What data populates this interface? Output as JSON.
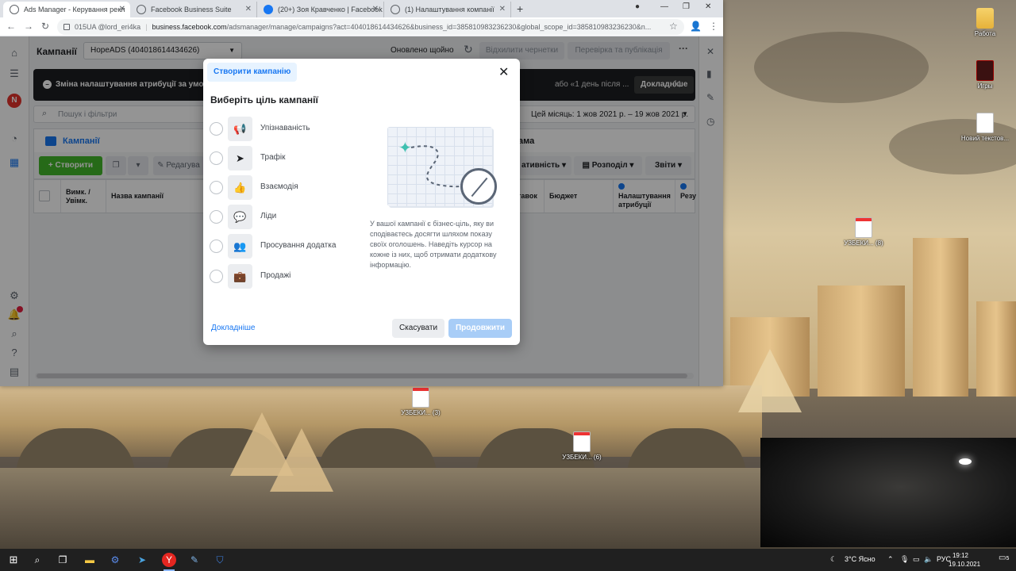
{
  "browser": {
    "tabs": [
      {
        "title": "Ads Manager - Керування рекл",
        "active": true
      },
      {
        "title": "Facebook Business Suite",
        "active": false
      },
      {
        "title": "(20+) Зоя Кравченко | Facebook",
        "active": false
      },
      {
        "title": "(1) Налаштування компанії",
        "active": false
      }
    ],
    "address": {
      "account": "015UA @lord_eri4ka",
      "url_host": "business.facebook.com",
      "url_path": "/adsmanager/manage/campaigns?act=404018614434626&business_id=385810983236230&global_scope_id=385810983236230&n..."
    }
  },
  "app": {
    "header": {
      "title": "Кампанії",
      "account": "HopeADS (404018614434626)",
      "updated": "Оновлено щойно",
      "discard_drafts": "Відхилити чернетки",
      "review_publish": "Перевірка та публікація"
    },
    "banner": {
      "text": "Зміна налаштування атрибуції за умовча",
      "text_tail": "або «1 день після ...",
      "more": "Докладніше"
    },
    "search": {
      "placeholder": "Пошук і фільтри",
      "date_range": "Цей місяць: 1 жов 2021 р. – 19 жов 2021 р."
    },
    "tabs": {
      "campaigns": "Кампанії",
      "ads_tail": "ама"
    },
    "toolbar": {
      "create": "+ Створити",
      "edit": "Редагува",
      "performance": "ативність",
      "breakdown": "Розподіл",
      "reports": "Звіти"
    },
    "table": {
      "col_onoff": "Вимк. / Увімк.",
      "col_name": "Назва кампанії",
      "col_bid": "тавок",
      "col_budget": "Бюджет",
      "col_attribution": "Налаштування атрибуції",
      "col_results": "Резу"
    },
    "rail": {
      "avatar_initial": "N"
    }
  },
  "modal": {
    "tab": "Створити кампанію",
    "title": "Виберіть ціль кампанії",
    "objectives": [
      {
        "label": "Упізнаваність",
        "icon": "megaphone-icon",
        "glyph": "📢"
      },
      {
        "label": "Трафік",
        "icon": "cursor-icon",
        "glyph": "➤"
      },
      {
        "label": "Взаємодія",
        "icon": "thumbs-up-icon",
        "glyph": "👍"
      },
      {
        "label": "Ліди",
        "icon": "chat-bubbles-icon",
        "glyph": "💬"
      },
      {
        "label": "Просування додатка",
        "icon": "people-icon",
        "glyph": "👥"
      },
      {
        "label": "Продажі",
        "icon": "briefcase-icon",
        "glyph": "💼"
      }
    ],
    "description": "У вашої кампанії є бізнес-ціль, яку ви сподіваєтесь досягти шляхом показу своїх оголошень. Наведіть курсор на кожне із них, щоб отримати додаткову інформацію.",
    "learn_more": "Докладніше",
    "cancel": "Скасувати",
    "continue": "Продовжити"
  },
  "desktop": {
    "icons": [
      {
        "label": "Работа",
        "type": "folder"
      },
      {
        "label": "Игры",
        "type": "game"
      },
      {
        "label": "Новий текстов...",
        "type": "doc"
      },
      {
        "label": "УЗБЕКИ... (8)",
        "type": "doc-red"
      },
      {
        "label": "УЗБЕКИ... (3)",
        "type": "doc-red"
      },
      {
        "label": "УЗБЕКИ... (6)",
        "type": "doc-red"
      }
    ]
  },
  "taskbar": {
    "weather": "3°C Ясно",
    "lang": "РУС",
    "time": "19:12",
    "date": "19.10.2021",
    "notifications": "5"
  }
}
